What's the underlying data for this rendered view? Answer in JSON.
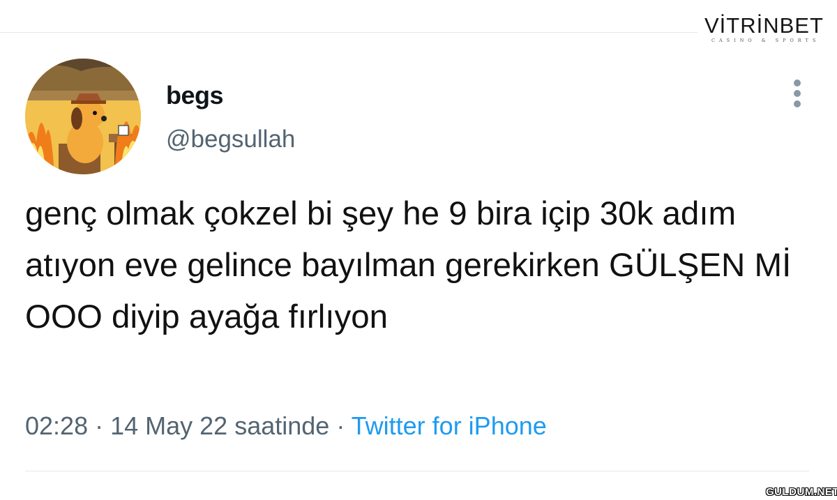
{
  "watermark": {
    "top_brand": "VİTRİNBET",
    "top_tagline": "CASINO & SPORTS",
    "bottom": "GULDUM.NET"
  },
  "tweet": {
    "display_name": "begs",
    "handle": "@begsullah",
    "text": "genç olmak çokzel bi şey he 9 bira içip 30k adım atıyon eve gelince bayılman gerekirken GÜLŞEN Mİ OOO diyip ayağa fırlıyon",
    "time": "02:28",
    "date": "14 May 22 saatinde",
    "separator": " · ",
    "source": "Twitter for iPhone",
    "avatar_icon": "this-is-fine-dog-avatar",
    "menu_icon": "more-vertical-icon"
  },
  "colors": {
    "text": "#0f1419",
    "secondary": "#536471",
    "link": "#1d9bf0",
    "menu_dots": "#8899a6"
  }
}
